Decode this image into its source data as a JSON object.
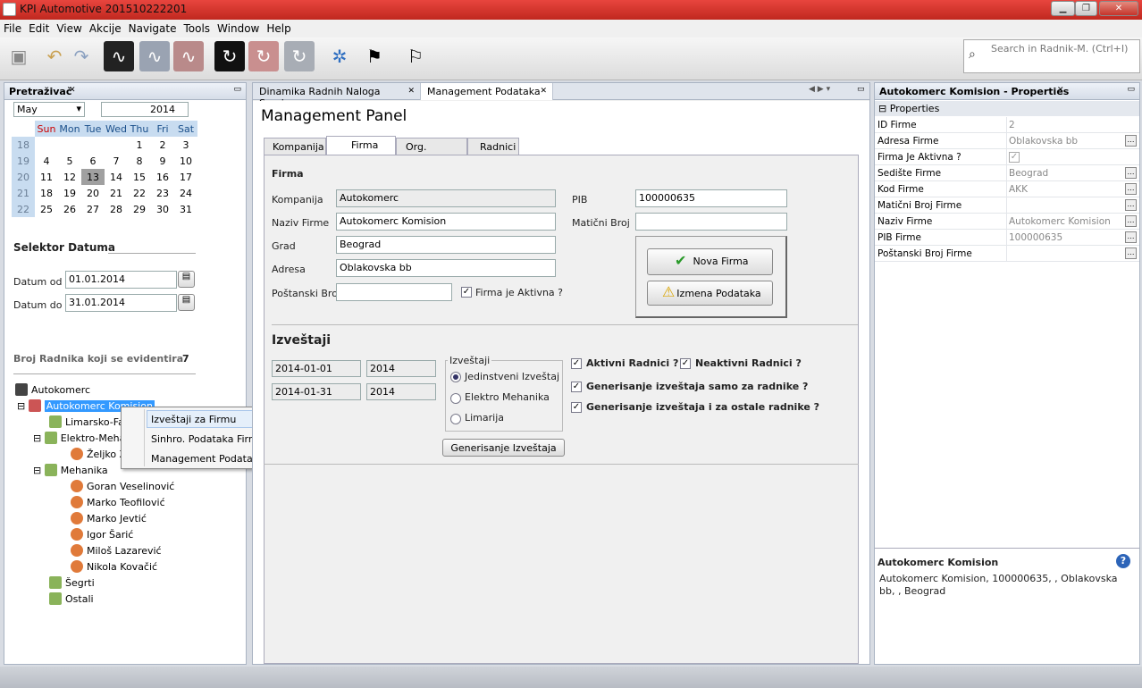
{
  "app": {
    "title": "KPI Automotive 201510222201"
  },
  "menu": [
    "File",
    "Edit",
    "View",
    "Akcije",
    "Navigate",
    "Tools",
    "Window",
    "Help"
  ],
  "search": {
    "placeholder": "Search in Radnik-M. (Ctrl+I)"
  },
  "left": {
    "title": "Pretraživač",
    "calendar": {
      "month": "May",
      "year": "2014",
      "days": [
        "Sun",
        "Mon",
        "Tue",
        "Wed",
        "Thu",
        "Fri",
        "Sat"
      ],
      "weeks": [
        {
          "wk": "18",
          "d": [
            "",
            "",
            "",
            "",
            "1",
            "2",
            "3"
          ]
        },
        {
          "wk": "19",
          "d": [
            "4",
            "5",
            "6",
            "7",
            "8",
            "9",
            "10"
          ]
        },
        {
          "wk": "20",
          "d": [
            "11",
            "12",
            "13",
            "14",
            "15",
            "16",
            "17"
          ]
        },
        {
          "wk": "21",
          "d": [
            "18",
            "19",
            "20",
            "21",
            "22",
            "23",
            "24"
          ]
        },
        {
          "wk": "22",
          "d": [
            "25",
            "26",
            "27",
            "28",
            "29",
            "30",
            "31"
          ]
        }
      ]
    },
    "selector_title": "Selektor Datuma",
    "date_from_label": "Datum od",
    "date_from": "01.01.2014",
    "date_to_label": "Datum do",
    "date_to": "31.01.2014",
    "count_label": "Broj Radnika koji se evidentira",
    "count": "7",
    "tree": {
      "root": "Autokomerc",
      "firm": "Autokomerc Komision",
      "n1": "Limarsko-Far",
      "n2": "Elektro-Meha",
      "n2a": "Željko Ža",
      "n3": "Mehanika",
      "workers": [
        "Goran Veselinović",
        "Marko Teofilović",
        "Marko Jevtić",
        "Igor Šarić",
        "Miloš Lazarević",
        "Nikola Kovačić"
      ],
      "n4": "Šegrti",
      "n5": "Ostali"
    },
    "context_menu": [
      "Izveštaji za Firmu",
      "Sinhro. Podataka Firme",
      "Management Podataka"
    ]
  },
  "center": {
    "tabs": [
      "Dinamika Radnih Naloga Servisa",
      "Management Podataka"
    ],
    "title": "Management Panel",
    "subtabs": [
      "Kompanija",
      "Firma",
      "Org. Jedinica",
      "Radnici"
    ],
    "firma": {
      "section": "Firma",
      "kompanija_label": "Kompanija",
      "kompanija": "Autokomerc",
      "naziv_label": "Naziv Firme",
      "naziv": "Autokomerc Komision",
      "grad_label": "Grad",
      "grad": "Beograd",
      "adresa_label": "Adresa",
      "adresa": "Oblakovska bb",
      "postanski_label": "Poštanski Broj",
      "postanski": "",
      "aktivna_label": "Firma je Aktivna ?",
      "pib_label": "PIB",
      "pib": "100000635",
      "maticni_label": "Matični Broj",
      "maticni": "",
      "nova_btn": "Nova Firma",
      "izmena_btn": "Izmena Podataka"
    },
    "izv": {
      "section": "Izveštaji",
      "d1": "2014-01-01",
      "y1": "2014",
      "d2": "2014-01-31",
      "y2": "2014",
      "group": "Izveštaji",
      "r1": "Jedinstveni Izveštaj",
      "r2": "Elektro Mehanika",
      "r3": "Limarija",
      "c1": "Aktivni Radnici ?",
      "c2": "Neaktivni Radnici ?",
      "c3": "Generisanje izveštaja samo za radnike ?",
      "c4": "Generisanje izveštaja i za ostale radnike ?",
      "gen_btn": "Generisanje Izveštaja"
    }
  },
  "right": {
    "title": "Autokomerc Komision - Properties",
    "section": "Properties",
    "props": [
      {
        "k": "ID Firme",
        "v": "2",
        "e": false
      },
      {
        "k": "Adresa Firme",
        "v": "Oblakovska bb",
        "e": true
      },
      {
        "k": "Firma Je Aktivna ?",
        "v": "",
        "e": false
      },
      {
        "k": "Sedište Firme",
        "v": "Beograd",
        "e": true
      },
      {
        "k": "Kod Firme",
        "v": "AKK",
        "e": true
      },
      {
        "k": "Matični Broj Firme",
        "v": "",
        "e": true
      },
      {
        "k": "Naziv Firme",
        "v": "Autokomerc Komision",
        "e": true
      },
      {
        "k": "PIB Firme",
        "v": "100000635",
        "e": true
      },
      {
        "k": "Poštanski Broj Firme",
        "v": "",
        "e": true
      }
    ],
    "desc_title": "Autokomerc Komision",
    "desc_text": "Autokomerc Komision, 100000635, , Oblakovska bb, , Beograd"
  },
  "colors": {
    "accent": "#3399ff",
    "title": "#d0342c"
  }
}
